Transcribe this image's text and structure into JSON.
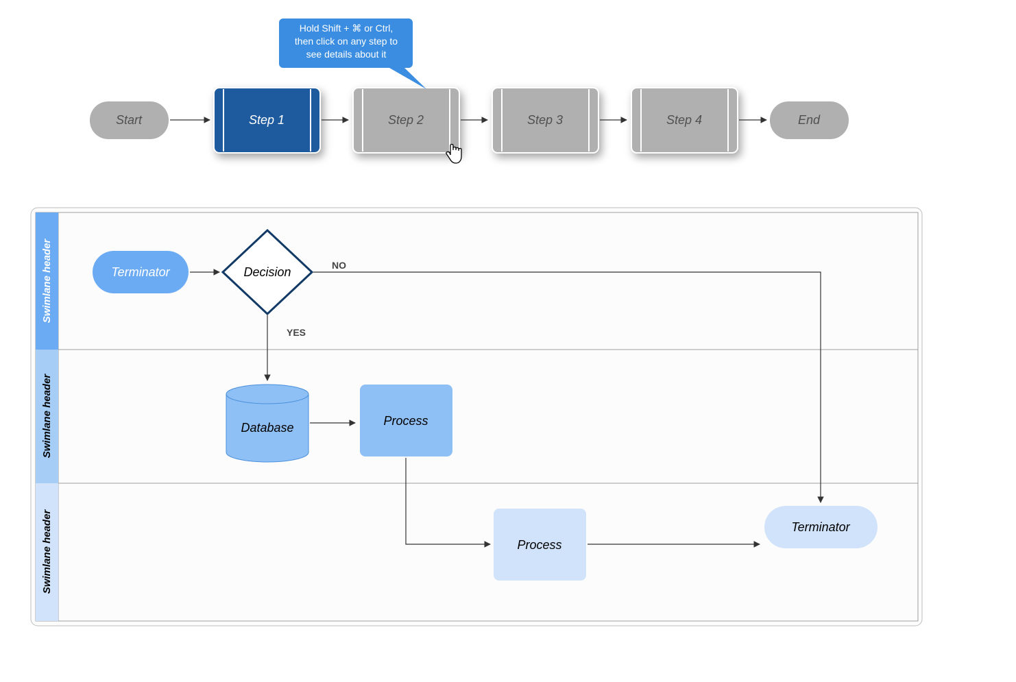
{
  "top_flow": {
    "start": "Start",
    "steps": [
      "Step 1",
      "Step 2",
      "Step 3",
      "Step 4"
    ],
    "end": "End",
    "selected_index": 0,
    "tooltip": {
      "line1": "Hold Shift + ⌘ or Ctrl,",
      "line2": "then click on any step to",
      "line3": "see details about it"
    }
  },
  "swimlane": {
    "headers": [
      "Swimlane header",
      "Swimlane header",
      "Swimlane header"
    ],
    "nodes": {
      "terminator_start": "Terminator",
      "decision": "Decision",
      "decision_yes": "YES",
      "decision_no": "NO",
      "database": "Database",
      "process1": "Process",
      "process2": "Process",
      "terminator_end": "Terminator"
    }
  }
}
